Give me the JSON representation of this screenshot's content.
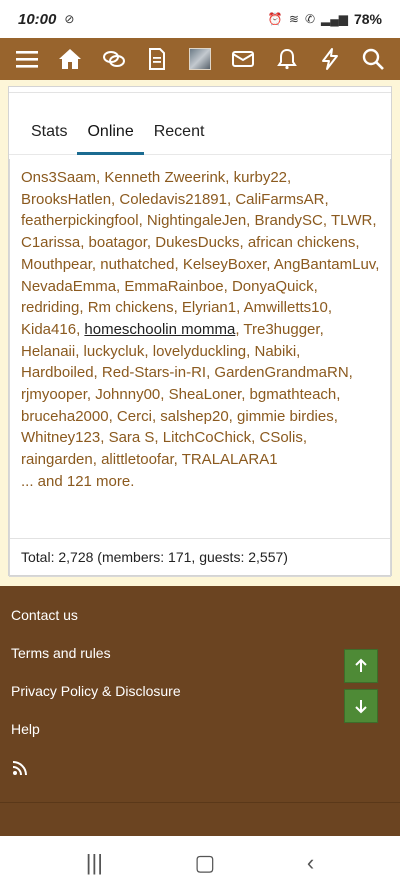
{
  "status": {
    "time": "10:00",
    "battery": "78%"
  },
  "tabs": [
    {
      "label": "Stats"
    },
    {
      "label": "Online"
    },
    {
      "label": "Recent"
    }
  ],
  "online": {
    "names": [
      "Ons3Saam",
      "Kenneth Zweerink",
      "kurby22",
      "BrooksHatlen",
      "Coledavis21891",
      "CaliFarmsAR",
      "featherpickingfool",
      "NightingaleJen",
      "BrandySC",
      "TLWR",
      "C1arissa",
      "boatagor",
      "DukesDucks",
      "african chickens",
      "Mouthpear",
      "nuthatched",
      "KelseyBoxer",
      "AngBantamLuv",
      "NevadaEmma",
      "EmmaRainboe",
      "DonyaQuick",
      "redriding",
      "Rm chickens",
      "Elyrian1",
      "Amwilletts10",
      "Kida416",
      "homeschoolin momma",
      "Tre3hugger",
      "Helanaii",
      "luckycluk",
      "lovelyduckling",
      "Nabiki",
      "Hardboiled",
      "Red-Stars-in-RI",
      "GardenGrandmaRN",
      "rjmyooper",
      "Johnny00",
      "SheaLoner",
      "bgmathteach",
      "bruceha2000",
      "Cerci",
      "salshep20",
      "gimmie birdies",
      "Whitney123",
      "Sara S",
      "LitchCoChick",
      "CSolis",
      "raingarden",
      "alittletoofar",
      "TRALALARA1"
    ],
    "more": "... and 121 more.",
    "total": "Total: 2,728 (members: 171, guests: 2,557)"
  },
  "footer": {
    "links": [
      "Contact us",
      "Terms and rules",
      "Privacy Policy & Disclosure",
      "Help"
    ]
  },
  "colors": {
    "brand": "#98642d",
    "footer": "#6b4421",
    "link": "#8b5a1f",
    "tab_active": "#1b6b91",
    "scroll_btn": "#4e8a36"
  }
}
